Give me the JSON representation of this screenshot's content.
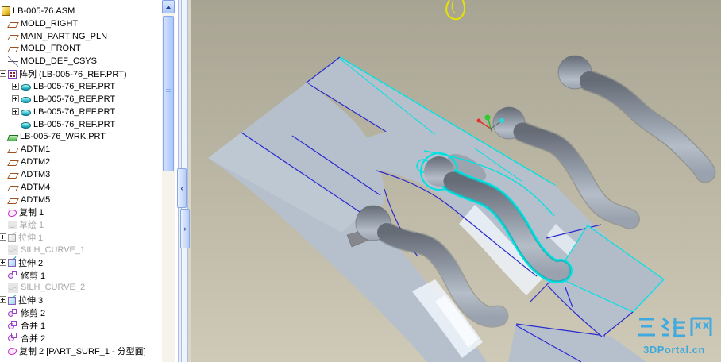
{
  "window": {
    "app": "Pro/ENGINEER mold design"
  },
  "tree": {
    "items": [
      {
        "label": "LB-005-76.ASM",
        "icon": "assembly",
        "level": 0
      },
      {
        "label": "MOLD_RIGHT",
        "icon": "datum-plane",
        "level": 1
      },
      {
        "label": "MAIN_PARTING_PLN",
        "icon": "datum-plane",
        "level": 1
      },
      {
        "label": "MOLD_FRONT",
        "icon": "datum-plane",
        "level": 1
      },
      {
        "label": "MOLD_DEF_CSYS",
        "icon": "csys",
        "level": 1
      },
      {
        "label": "阵列 (LB-005-76_REF.PRT)",
        "icon": "pattern",
        "level": 1,
        "expand": "minus"
      },
      {
        "label": "LB-005-76_REF.PRT",
        "icon": "part",
        "level": 2,
        "expand": "plus"
      },
      {
        "label": "LB-005-76_REF.PRT",
        "icon": "part",
        "level": 2,
        "expand": "plus"
      },
      {
        "label": "LB-005-76_REF.PRT",
        "icon": "part",
        "level": 2,
        "expand": "plus"
      },
      {
        "label": "LB-005-76_REF.PRT",
        "icon": "part",
        "level": 2
      },
      {
        "label": "LB-005-76_WRK.PRT",
        "icon": "workpiece",
        "level": 1
      },
      {
        "label": "ADTM1",
        "icon": "datum-plane",
        "level": 1
      },
      {
        "label": "ADTM2",
        "icon": "datum-plane",
        "level": 1
      },
      {
        "label": "ADTM3",
        "icon": "datum-plane",
        "level": 1
      },
      {
        "label": "ADTM4",
        "icon": "datum-plane",
        "level": 1
      },
      {
        "label": "ADTM5",
        "icon": "datum-plane",
        "level": 1
      },
      {
        "label": "复制 1",
        "icon": "copy",
        "level": 1
      },
      {
        "label": "草绘 1",
        "icon": "sketch",
        "level": 1,
        "suppressed": true
      },
      {
        "label": "拉伸 1",
        "icon": "extrude",
        "level": 1,
        "suppressed": true,
        "expand": "plus"
      },
      {
        "label": "SILH_CURVE_1",
        "icon": "silhouette",
        "level": 1,
        "suppressed": true
      },
      {
        "label": "拉伸 2",
        "icon": "extrude",
        "level": 1,
        "expand": "plus"
      },
      {
        "label": "修剪 1",
        "icon": "trim",
        "level": 1
      },
      {
        "label": "SILH_CURVE_2",
        "icon": "silhouette",
        "level": 1,
        "suppressed": true
      },
      {
        "label": "拉伸 3",
        "icon": "extrude",
        "level": 1,
        "expand": "plus"
      },
      {
        "label": "修剪 2",
        "icon": "trim",
        "level": 1
      },
      {
        "label": "合并 1",
        "icon": "merge",
        "level": 1
      },
      {
        "label": "合并 2",
        "icon": "merge",
        "level": 1
      },
      {
        "label": "复制 2 [PART_SURF_1 - 分型面]",
        "icon": "copy",
        "level": 1
      }
    ]
  },
  "watermark": {
    "title": "三维网",
    "subtitle": "3DPortal.cn"
  },
  "colors": {
    "edge_blue": "#2a2ace",
    "edge_cyan": "#00e2e2",
    "surface": "#b6c0cd",
    "bg_top": "#a8a493",
    "bg_bottom": "#cfcab7",
    "sup": "#a6a6a6",
    "wm": "#3fa9e0",
    "wm2": "#35a7dd",
    "sketch_yellow": "#e4e400",
    "csys_red": "#e03030",
    "csys_green": "#2ecc2e",
    "csys_cyan": "#28d8d8"
  }
}
